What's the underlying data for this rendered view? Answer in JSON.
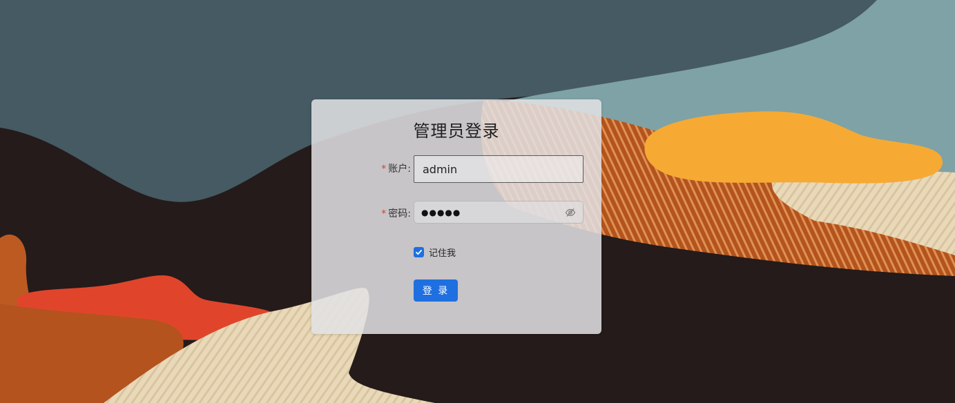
{
  "page": {
    "title": "管理员登录"
  },
  "form": {
    "account_label": "账户:",
    "account_value": "admin",
    "password_label": "密码:",
    "password_masked": "●●●●●",
    "required_mark": "*",
    "remember_label": "记住我",
    "remember_checked": true,
    "submit_label": "登 录"
  },
  "colors": {
    "accent": "#1f6fe0",
    "required": "#e23b2e"
  },
  "icons": {
    "password_toggle": "eye-off-icon",
    "checkbox": "check-icon"
  }
}
